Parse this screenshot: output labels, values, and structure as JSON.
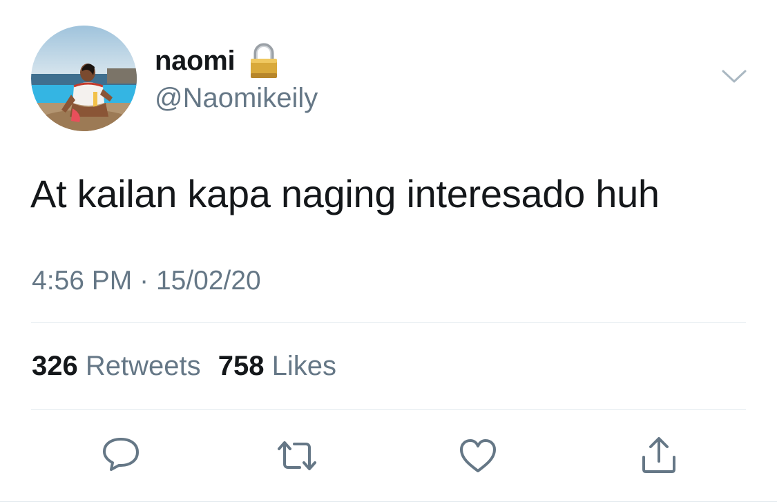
{
  "tweet": {
    "author": {
      "display_name": "naomi",
      "handle": "@Naomikeily",
      "protected_icon": "lock-icon",
      "avatar": "profile-photo"
    },
    "text": "At kailan kapa naging interesado huh",
    "time": "4:56 PM",
    "separator": "·",
    "date": "15/02/20",
    "stats": {
      "retweets_count": "326",
      "retweets_label": "Retweets",
      "likes_count": "758",
      "likes_label": "Likes"
    },
    "actions": [
      "reply-icon",
      "retweet-icon",
      "like-icon",
      "share-icon"
    ],
    "menu_icon": "chevron-down-icon"
  },
  "colors": {
    "primary_text": "#14171a",
    "secondary_text": "#657786",
    "divider": "#e1e8ed",
    "icon": "#657786"
  }
}
